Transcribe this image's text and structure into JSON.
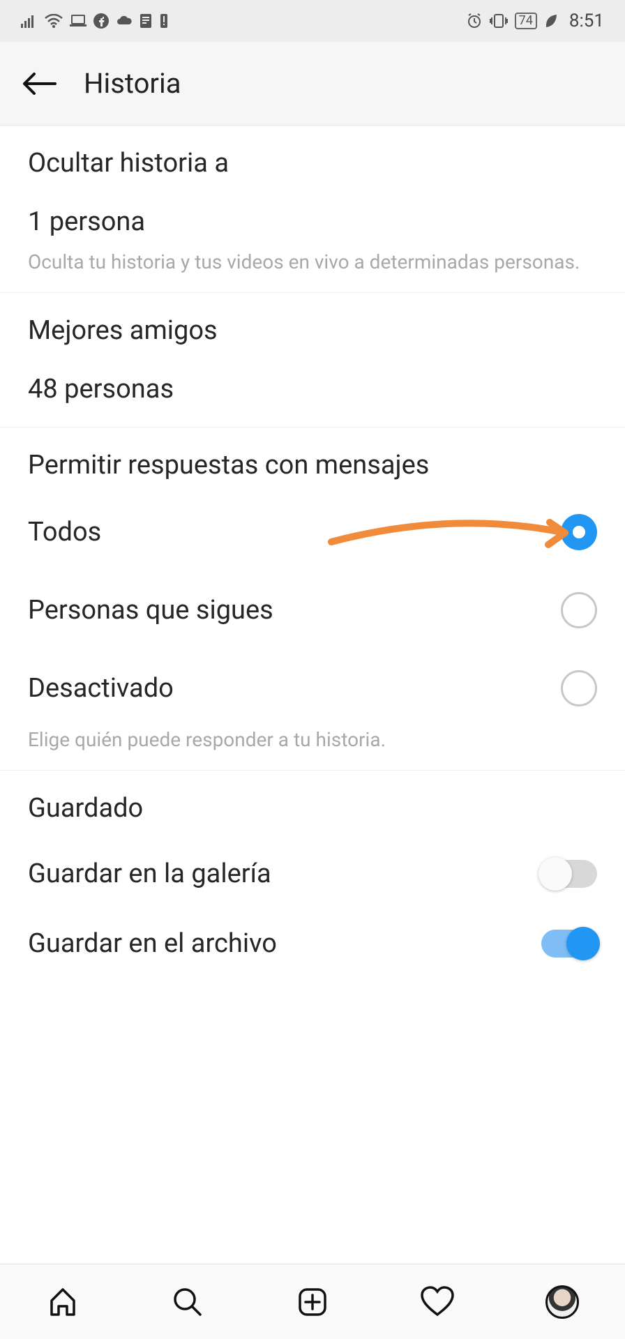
{
  "status_bar": {
    "battery": "74",
    "time": "8:51"
  },
  "header": {
    "title": "Historia"
  },
  "hide_story": {
    "title": "Ocultar historia a",
    "value": "1 persona",
    "desc": "Oculta tu historia y tus videos en vivo a determinadas personas."
  },
  "best_friends": {
    "title": "Mejores amigos",
    "value": "48 personas"
  },
  "allow_replies": {
    "title": "Permitir respuestas con mensajes",
    "options": {
      "todos": "Todos",
      "sigues": "Personas que sigues",
      "desactivado": "Desactivado"
    },
    "desc": "Elige quién puede responder a tu historia."
  },
  "saved": {
    "title": "Guardado",
    "gallery": "Guardar en la galería",
    "archive": "Guardar en el archivo"
  }
}
